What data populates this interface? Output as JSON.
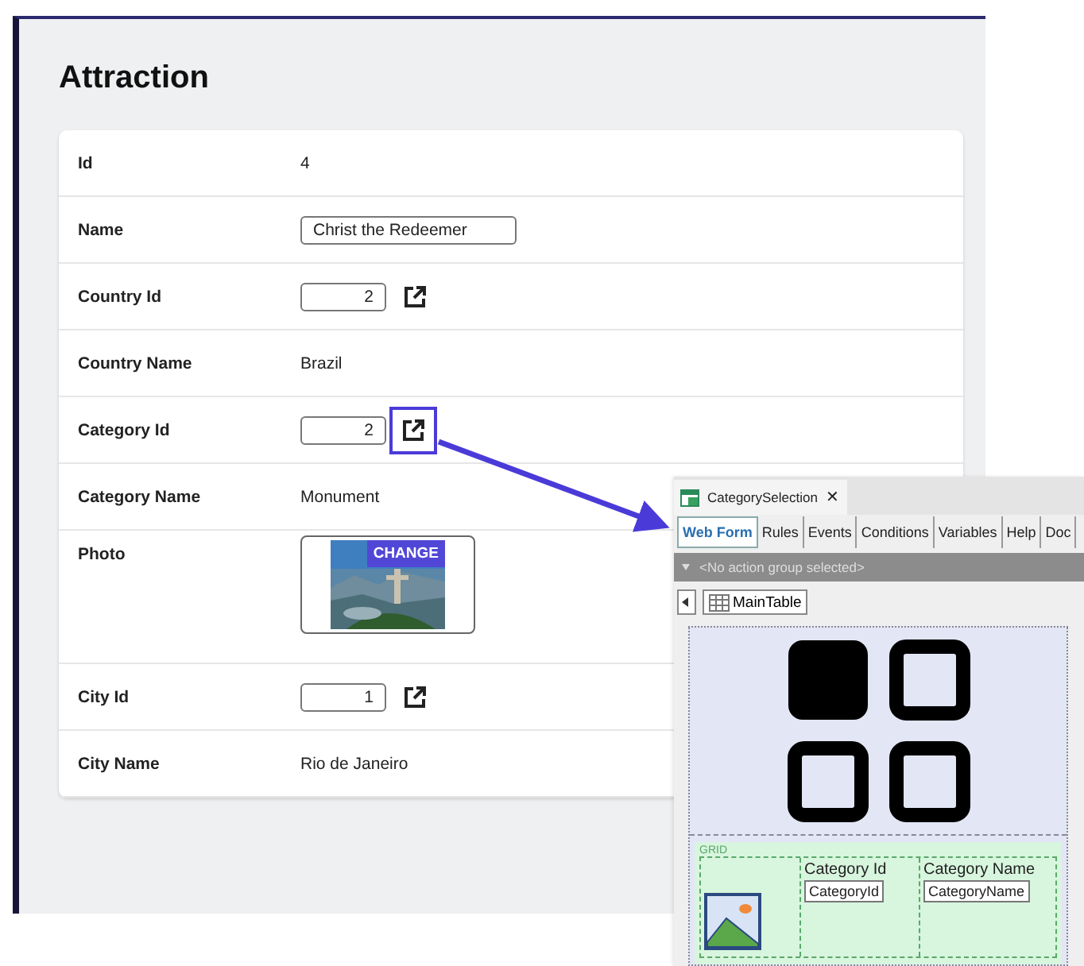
{
  "page": {
    "title": "Attraction"
  },
  "fields": [
    {
      "label": "Id",
      "kind": "text",
      "value": "4",
      "highlighted": false
    },
    {
      "label": "Name",
      "kind": "input",
      "value": "Christ the Redeemer",
      "highlighted": false
    },
    {
      "label": "Country Id",
      "kind": "number",
      "value": "2",
      "highlighted": false
    },
    {
      "label": "Country Name",
      "kind": "text",
      "value": "Brazil",
      "highlighted": false
    },
    {
      "label": "Category Id",
      "kind": "number",
      "value": "2",
      "highlighted": true
    },
    {
      "label": "Category Name",
      "kind": "text",
      "value": "Monument",
      "highlighted": false
    },
    {
      "label": "Photo",
      "value": "CHANGE",
      "highlighted": false
    },
    {
      "label": "City Id",
      "kind": "number",
      "value": "1",
      "highlighted": false
    },
    {
      "label": "City Name",
      "kind": "text",
      "value": "Rio de Janeiro",
      "highlighted": false
    }
  ],
  "designer": {
    "tab_title": "CategorySelection",
    "close": "✕",
    "tabs": [
      {
        "label": "Web Form",
        "selected": true
      },
      {
        "label": "Rules",
        "selected": false
      },
      {
        "label": "Events",
        "selected": false
      },
      {
        "label": "Conditions",
        "selected": false
      },
      {
        "label": "Variables",
        "selected": false
      },
      {
        "label": "Help",
        "selected": false
      },
      {
        "label": "Doc",
        "selected": false
      }
    ],
    "action_group": "<No action group selected>",
    "breadcrumb": "MainTable",
    "grid_label": "GRID",
    "columns": [
      {
        "header": "Category Id",
        "field": "CategoryId"
      },
      {
        "header": "Category Name",
        "field": "CategoryName"
      }
    ]
  }
}
